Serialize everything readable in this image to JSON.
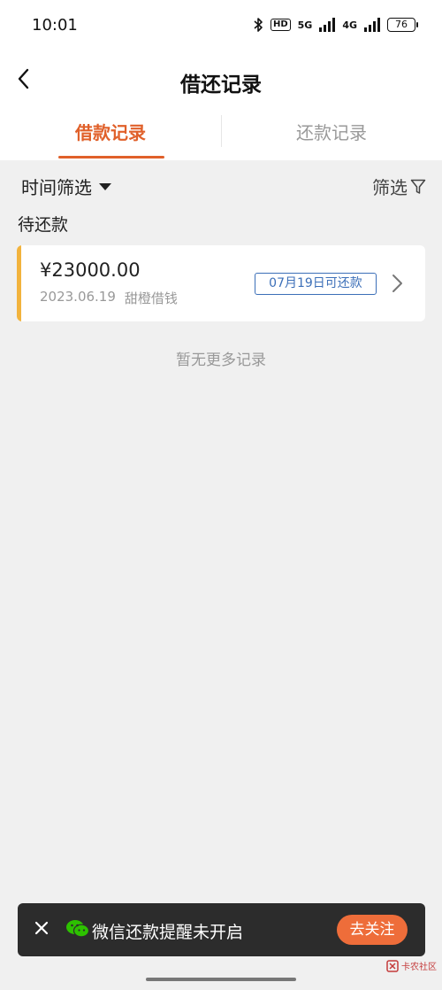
{
  "status_bar": {
    "time": "10:01",
    "hd_label": "HD",
    "network_1": "5G",
    "network_2": "4G",
    "battery": "76"
  },
  "nav": {
    "title": "借还记录"
  },
  "tabs": [
    {
      "label": "借款记录",
      "active": true
    },
    {
      "label": "还款记录",
      "active": false
    }
  ],
  "filters": {
    "time_filter_label": "时间筛选",
    "filter_label": "筛选"
  },
  "section": {
    "title": "待还款"
  },
  "records": [
    {
      "amount": "¥23000.00",
      "date": "2023.06.19",
      "product": "甜橙借钱",
      "due_badge": "07月19日可还款"
    }
  ],
  "empty_hint": "暂无更多记录",
  "banner": {
    "text": "微信还款提醒未开启",
    "button_label": "去关注"
  },
  "watermark": {
    "text": "卡农社区"
  },
  "colors": {
    "accent": "#e0602a",
    "card_accent": "#f2b33d",
    "badge_blue": "#3c6fb8",
    "banner_bg": "#2c2c2c",
    "follow_button": "#ee6d3a"
  }
}
